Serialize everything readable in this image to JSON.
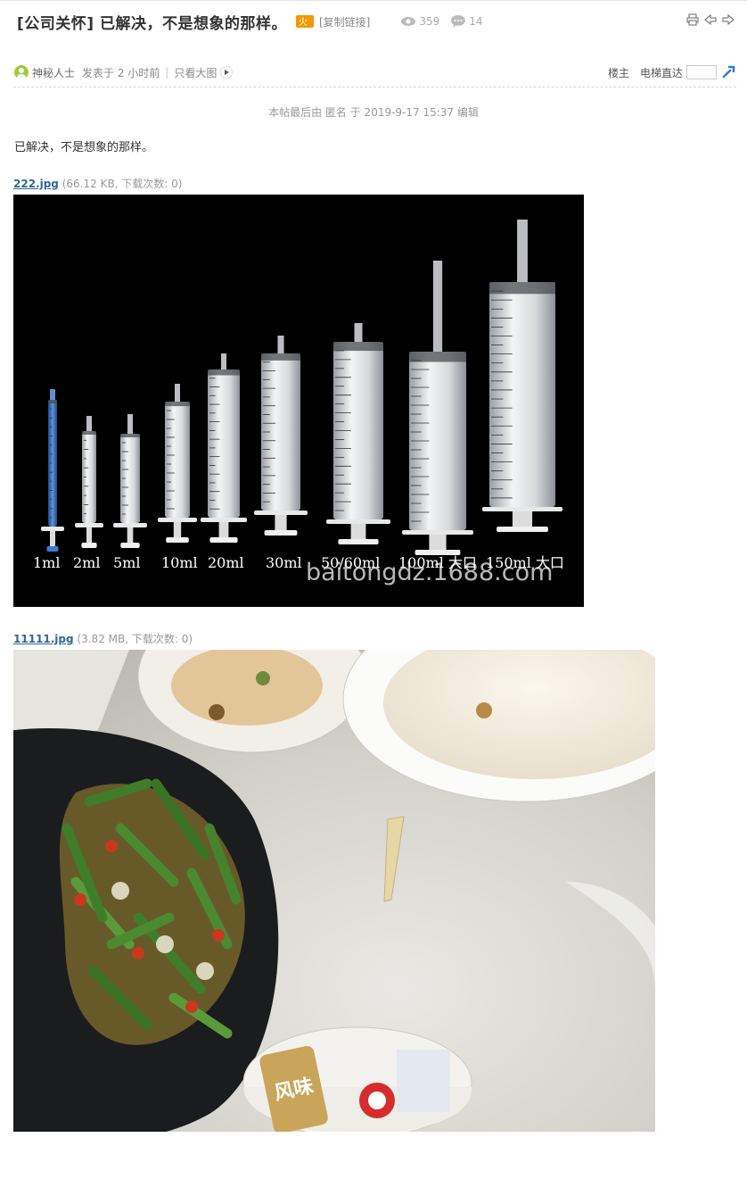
{
  "thread": {
    "title": "[公司关怀] 已解决，不是想象的那样。",
    "copy_link": "[复制链接]",
    "views": "359",
    "replies": "14"
  },
  "post": {
    "author": "神秘人士",
    "posted_time": "发表于 2 小时前",
    "only_large_images": "只看大图",
    "floor_owner": "楼主",
    "elevator_label": "电梯直达",
    "edit_note": "本帖最后由 匿名 于 2019-9-17 15:37 编辑",
    "body_text": "已解决，不是想象的那样。"
  },
  "attachments": [
    {
      "filename": "222.jpg",
      "meta": " (66.12 KB, 下载次数: 0)"
    },
    {
      "filename": "11111.jpg",
      "meta": " (3.82 MB, 下载次数: 0)"
    }
  ],
  "image1": {
    "sizes": [
      "1ml",
      "2ml",
      "5ml",
      "10ml",
      "20ml",
      "30ml",
      "50/60ml",
      "100ml 大口",
      "150ml 大口"
    ],
    "watermark": "baitongdz.1688.com"
  },
  "image2": {
    "cup_brand": "风味"
  },
  "colors": {
    "link": "#336699",
    "accent_hot": "#f39800",
    "avatar": "#9acb3c"
  },
  "icons": [
    "hot-icon",
    "eye-icon",
    "comment-icon",
    "print-icon",
    "prev-thread-icon",
    "next-thread-icon",
    "avatar",
    "play-icon",
    "jump-icon"
  ]
}
